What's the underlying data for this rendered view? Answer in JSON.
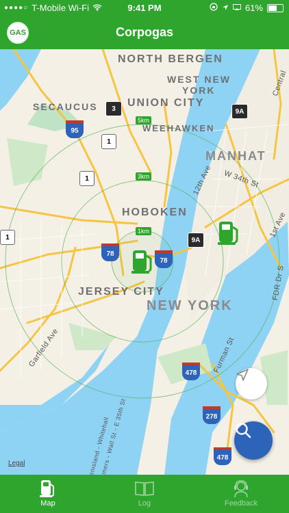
{
  "status_bar": {
    "carrier": "T-Mobile Wi-Fi",
    "time": "9:41 PM",
    "battery": "61%",
    "battery_level": 0.61
  },
  "navbar": {
    "logo_text": "GAS",
    "title": "Corpogas"
  },
  "map": {
    "places": {
      "north_bergen": "NORTH BERGEN",
      "west_new_york_1": "WEST NEW",
      "west_new_york_2": "YORK",
      "secaucus": "SECAUCUS",
      "union_city": "UNION CITY",
      "weehawken": "WEEHAWKEN",
      "manhattan": "MANHAT",
      "hoboken": "HOBOKEN",
      "jersey_city": "JERSEY CITY",
      "new_york": "NEW YORK",
      "central": "Central"
    },
    "streets": {
      "w34": "W 34th St",
      "12th": "12th Ave",
      "1st": "1st Ave",
      "fdr": "FDR Dr S",
      "garfield": "Garfield Ave",
      "furman": "Furman St",
      "wall_st": "mers - Wall St - E 35th St",
      "whitehall": "enisland - Whitehall"
    },
    "radius_labels": [
      "5km",
      "3km",
      "1km"
    ],
    "shields": {
      "r3": "3",
      "i95": "95",
      "us1a": "1",
      "us1b": "1",
      "us1c": "1",
      "r9a_top": "9A",
      "r9a_mid": "9A",
      "i78a": "78",
      "i78b": "78",
      "i478a": "478",
      "i478b": "478",
      "i278": "278"
    },
    "legal": "Legal"
  },
  "tabs": [
    {
      "label": "Map",
      "icon": "gas-pump-icon",
      "active": true
    },
    {
      "label": "Log",
      "icon": "book-icon",
      "active": false
    },
    {
      "label": "Feedback",
      "icon": "support-agent-icon",
      "active": false
    }
  ],
  "colors": {
    "brand_green": "#2ea52c",
    "water": "#8fd3f4",
    "search_button": "#2d63b9"
  }
}
